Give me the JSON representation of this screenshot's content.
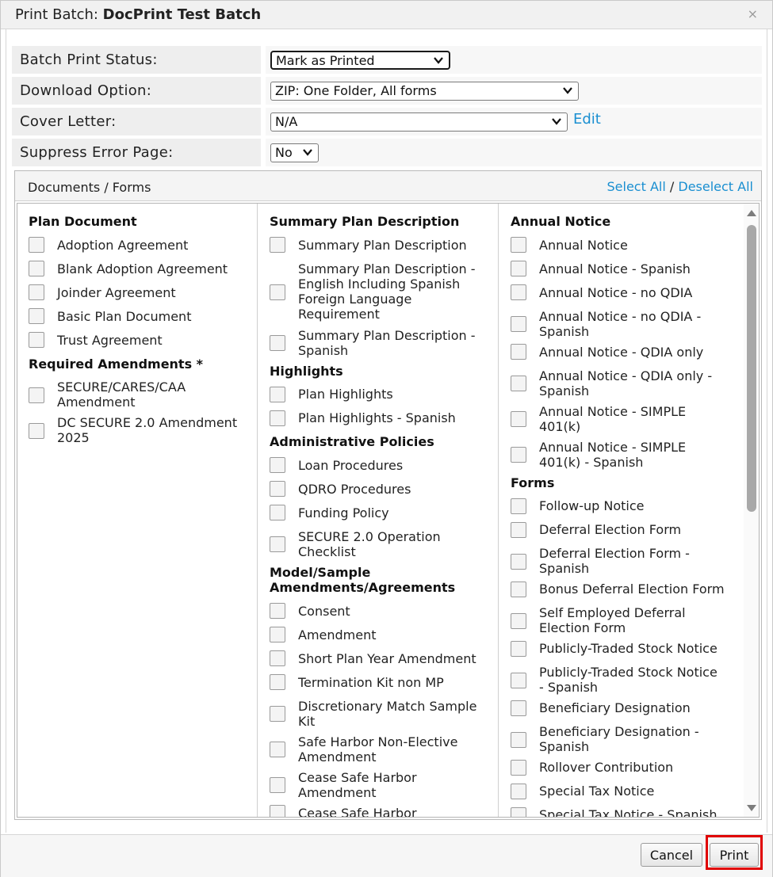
{
  "dialog": {
    "title_prefix": "Print Batch:",
    "title_name": "DocPrint Test Batch",
    "close_glyph": "×"
  },
  "settings": {
    "batch_print_status": {
      "label": "Batch Print Status:",
      "value": "Mark as Printed"
    },
    "download_option": {
      "label": "Download Option:",
      "value": "ZIP: One Folder, All forms"
    },
    "cover_letter": {
      "label": "Cover Letter:",
      "value": "N/A",
      "edit_link": "Edit"
    },
    "suppress_error_page": {
      "label": "Suppress Error Page:",
      "value": "No"
    }
  },
  "documents": {
    "header": "Documents / Forms",
    "select_all": "Select All",
    "separator": "/",
    "deselect_all": "Deselect All",
    "columns": [
      {
        "entries": [
          {
            "kind": "group",
            "text": "Plan Document"
          },
          {
            "kind": "item",
            "text": "Adoption Agreement"
          },
          {
            "kind": "item",
            "text": "Blank Adoption Agreement"
          },
          {
            "kind": "item",
            "text": "Joinder Agreement"
          },
          {
            "kind": "item",
            "text": "Basic Plan Document"
          },
          {
            "kind": "item",
            "text": "Trust Agreement"
          },
          {
            "kind": "group",
            "text": "Required Amendments *"
          },
          {
            "kind": "item",
            "text": "SECURE/CARES/CAA\nAmendment"
          },
          {
            "kind": "item",
            "text": "DC SECURE 2.0 Amendment\n2025"
          }
        ]
      },
      {
        "entries": [
          {
            "kind": "group",
            "text": "Summary Plan Description"
          },
          {
            "kind": "item",
            "text": "Summary Plan Description"
          },
          {
            "kind": "item",
            "text": "Summary Plan Description -\nEnglish Including Spanish\nForeign Language\nRequirement"
          },
          {
            "kind": "item",
            "text": "Summary Plan Description -\nSpanish"
          },
          {
            "kind": "group",
            "text": "Highlights"
          },
          {
            "kind": "item",
            "text": "Plan Highlights"
          },
          {
            "kind": "item",
            "text": "Plan Highlights - Spanish"
          },
          {
            "kind": "group",
            "text": "Administrative Policies"
          },
          {
            "kind": "item",
            "text": "Loan Procedures"
          },
          {
            "kind": "item",
            "text": "QDRO Procedures"
          },
          {
            "kind": "item",
            "text": "Funding Policy"
          },
          {
            "kind": "item",
            "text": "SECURE 2.0 Operation\nChecklist"
          },
          {
            "kind": "group",
            "text": "Model/Sample\nAmendments/Agreements"
          },
          {
            "kind": "item",
            "text": "Consent"
          },
          {
            "kind": "item",
            "text": "Amendment"
          },
          {
            "kind": "item",
            "text": "Short Plan Year Amendment"
          },
          {
            "kind": "item",
            "text": "Termination Kit non MP"
          },
          {
            "kind": "item",
            "text": "Discretionary Match Sample\nKit"
          },
          {
            "kind": "item",
            "text": "Safe Harbor Non-Elective\nAmendment"
          },
          {
            "kind": "item",
            "text": "Cease Safe Harbor\nAmendment"
          },
          {
            "kind": "item",
            "text": "Cease Safe Harbor"
          }
        ]
      },
      {
        "entries": [
          {
            "kind": "group",
            "text": "Annual Notice"
          },
          {
            "kind": "item",
            "text": "Annual Notice"
          },
          {
            "kind": "item",
            "text": "Annual Notice - Spanish"
          },
          {
            "kind": "item",
            "text": "Annual Notice - no QDIA"
          },
          {
            "kind": "item",
            "text": "Annual Notice - no QDIA -\nSpanish"
          },
          {
            "kind": "item",
            "text": "Annual Notice - QDIA only"
          },
          {
            "kind": "item",
            "text": "Annual Notice - QDIA only -\nSpanish"
          },
          {
            "kind": "item",
            "text": "Annual Notice - SIMPLE\n401(k)"
          },
          {
            "kind": "item",
            "text": "Annual Notice - SIMPLE\n401(k) - Spanish"
          },
          {
            "kind": "group",
            "text": "Forms"
          },
          {
            "kind": "item",
            "text": "Follow-up Notice"
          },
          {
            "kind": "item",
            "text": "Deferral Election Form"
          },
          {
            "kind": "item",
            "text": "Deferral Election Form -\nSpanish"
          },
          {
            "kind": "item",
            "text": "Bonus Deferral Election Form"
          },
          {
            "kind": "item",
            "text": "Self Employed Deferral\nElection Form"
          },
          {
            "kind": "item",
            "text": "Publicly-Traded Stock Notice"
          },
          {
            "kind": "item",
            "text": "Publicly-Traded Stock Notice\n- Spanish"
          },
          {
            "kind": "item",
            "text": "Beneficiary Designation"
          },
          {
            "kind": "item",
            "text": "Beneficiary Designation -\nSpanish"
          },
          {
            "kind": "item",
            "text": "Rollover Contribution"
          },
          {
            "kind": "item",
            "text": "Special Tax Notice"
          },
          {
            "kind": "item",
            "text": "Special Tax Notice - Spanish"
          }
        ]
      }
    ]
  },
  "footer": {
    "cancel_label": "Cancel",
    "print_label": "Print",
    "highlight_color": "#e00000"
  }
}
